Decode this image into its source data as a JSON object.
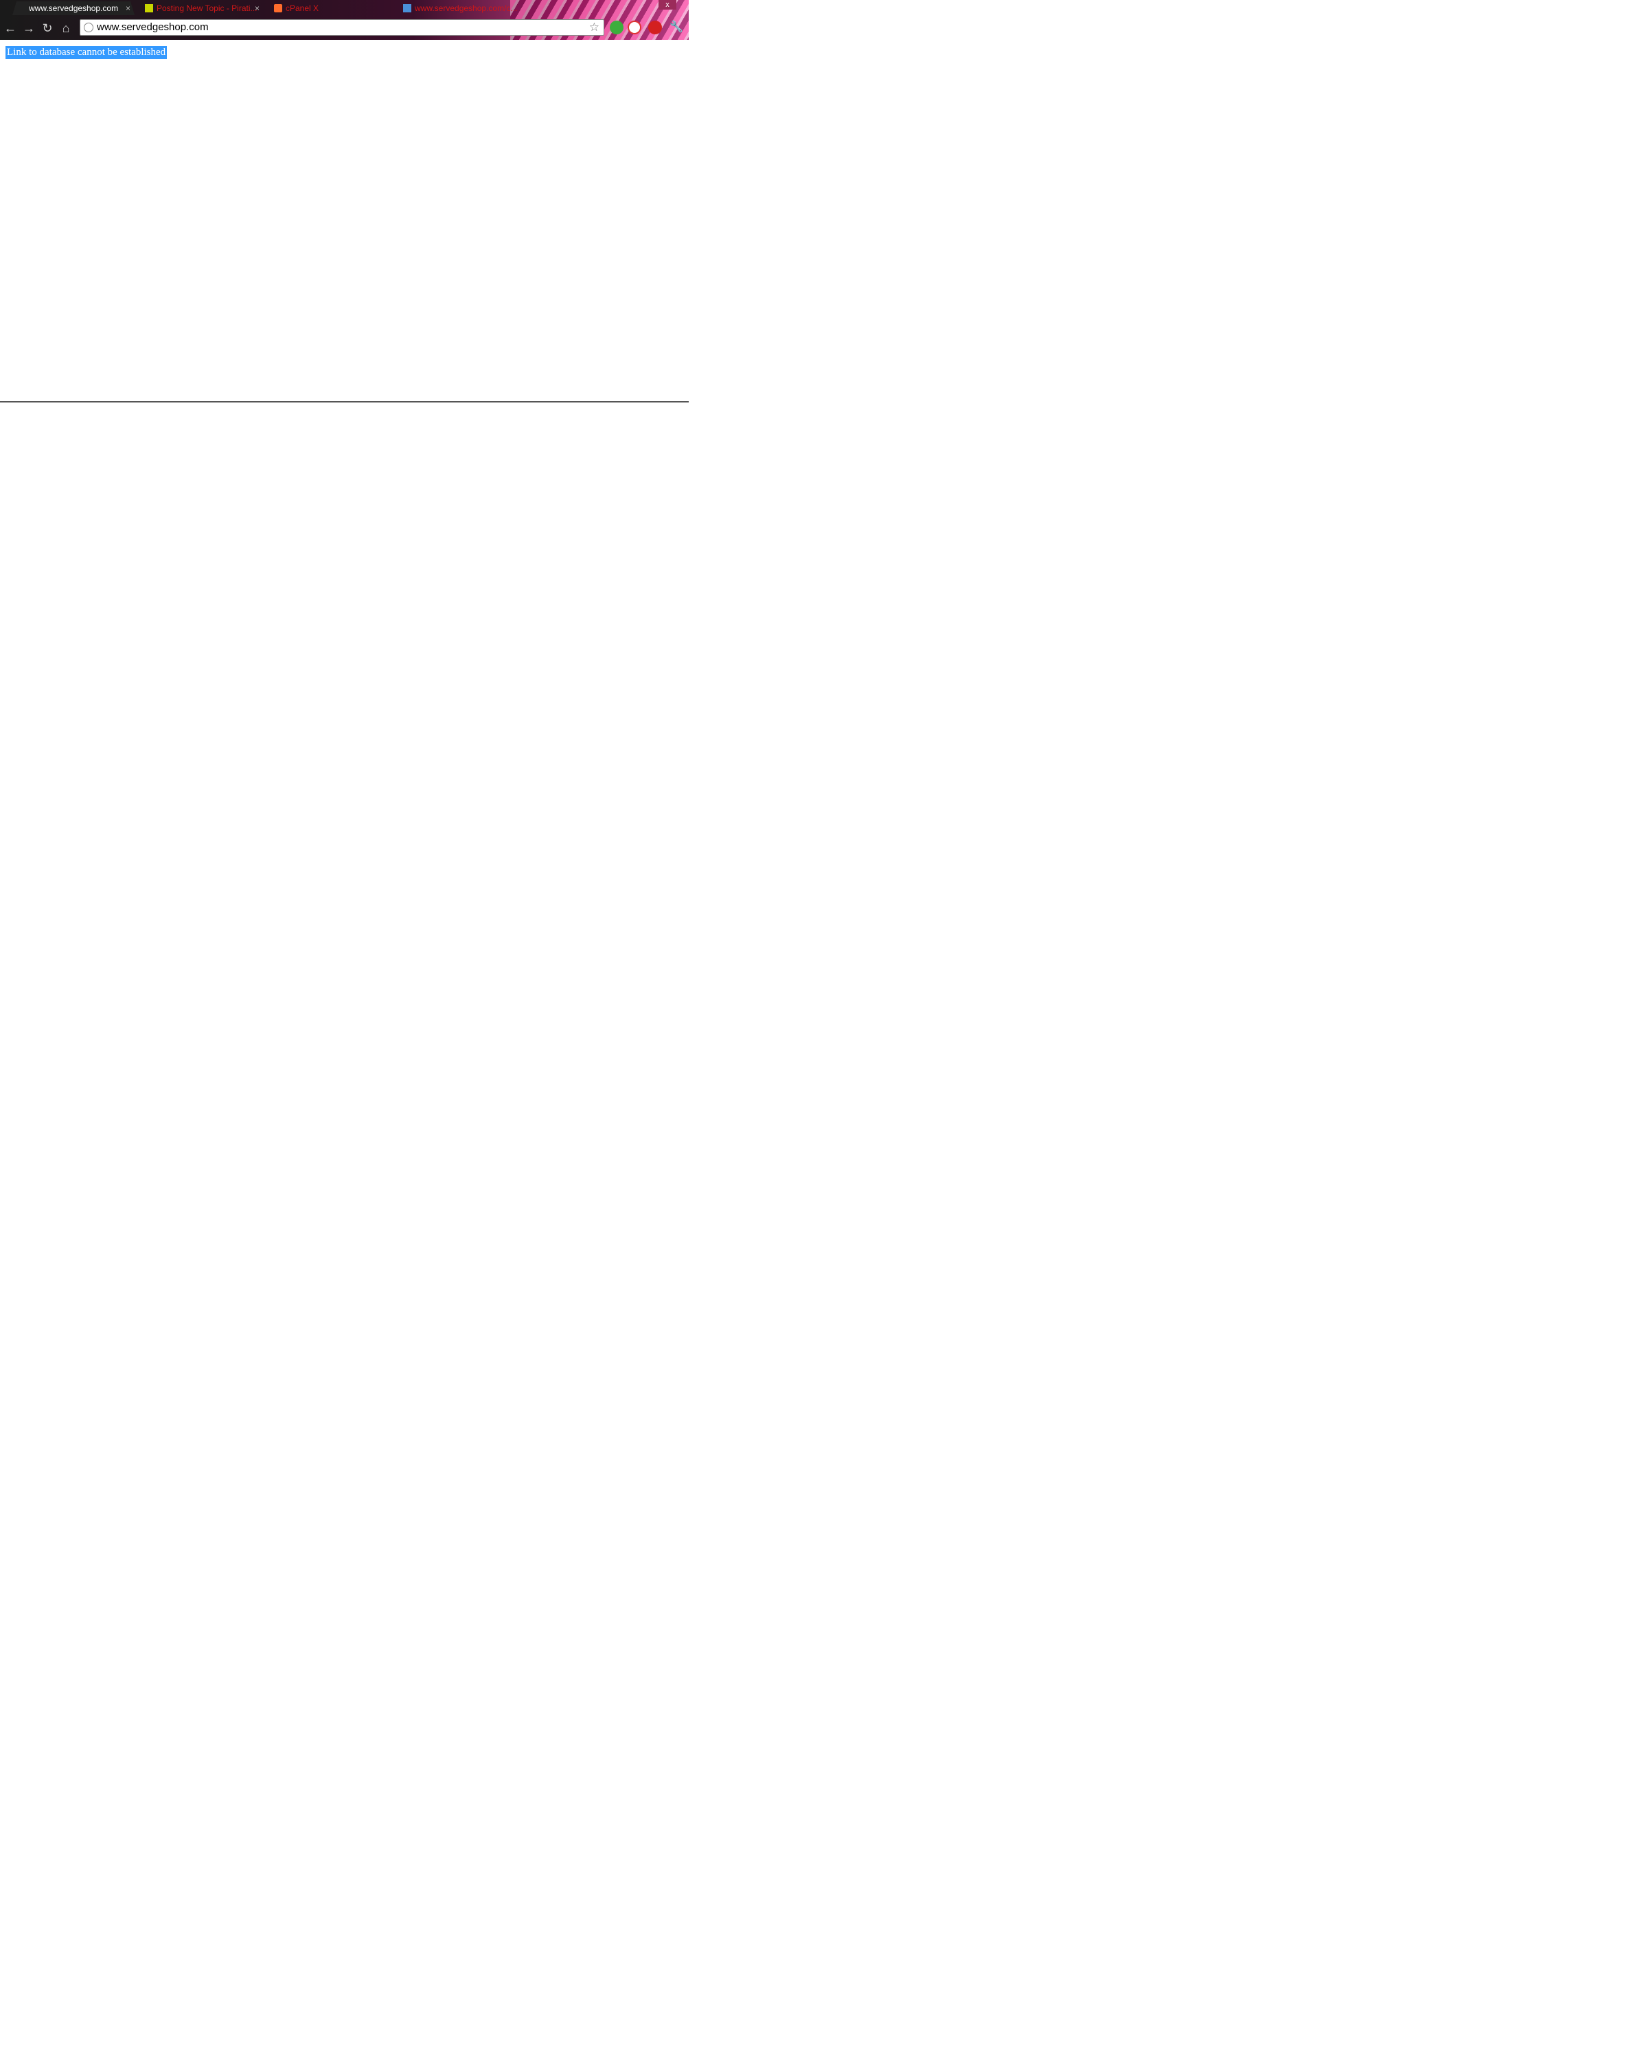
{
  "browser": {
    "tabs": [
      {
        "title": "www.servedgeshop.com",
        "active": true,
        "favicon": "page-icon"
      },
      {
        "title": "Posting New Topic - Pirati...",
        "active": false,
        "favicon": "forum-icon"
      },
      {
        "title": "cPanel X",
        "active": false,
        "favicon": "cpanel-icon"
      },
      {
        "title": "www.servedgeshop.com/c...",
        "active": false,
        "favicon": "page-icon"
      }
    ],
    "close_symbol": "×",
    "window_close": "x",
    "address_bar": {
      "url": "www.servedgeshop.com"
    },
    "toolbar_icons": [
      "back-icon",
      "forward-icon",
      "reload-icon",
      "home-icon",
      "star-icon",
      "wrench-icon"
    ]
  },
  "page": {
    "error_message": "Link to database cannot be established"
  },
  "colors": {
    "selection": "#3399ff",
    "tab_inactive_text": "#d01818"
  }
}
